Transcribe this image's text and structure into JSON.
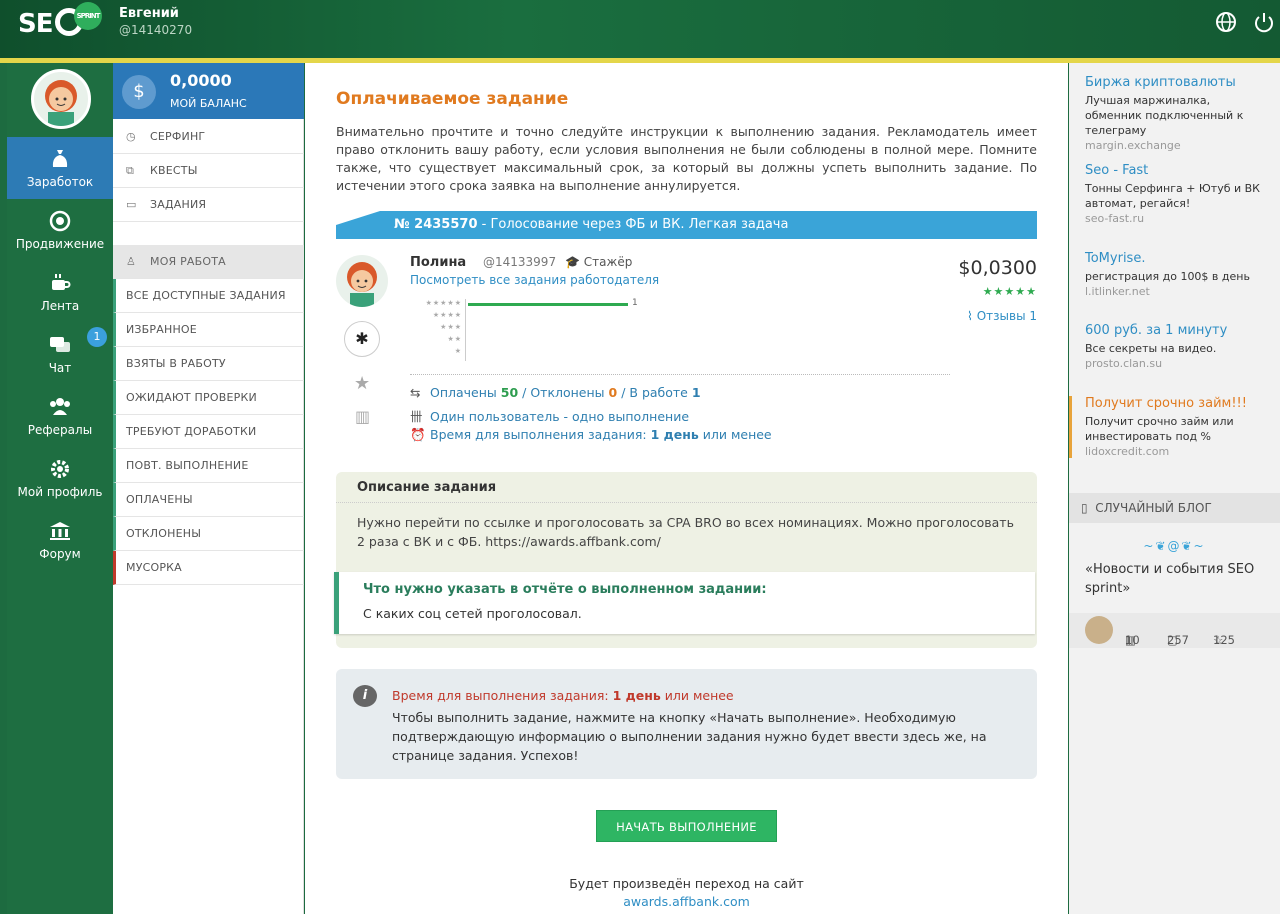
{
  "header": {
    "logo_text": "SE",
    "logo_badge": "SPRINT",
    "user_name": "Евгений",
    "user_id": "@14140270"
  },
  "left_nav": {
    "items": [
      {
        "label": "Заработок",
        "icon": "money-bag-icon",
        "active": true
      },
      {
        "label": "Продвижение",
        "icon": "target-icon"
      },
      {
        "label": "Лента",
        "icon": "coffee-icon"
      },
      {
        "label": "Чат",
        "icon": "chat-icon",
        "badge": "1"
      },
      {
        "label": "Рефералы",
        "icon": "people-icon"
      },
      {
        "label": "Мой профиль",
        "icon": "gear-icon"
      },
      {
        "label": "Форум",
        "icon": "building-icon"
      }
    ]
  },
  "balance": {
    "amount": "0,0000",
    "label": "МОЙ БАЛАНС"
  },
  "menu": {
    "top": [
      {
        "label": "СЕРФИНГ",
        "icon": "clock-icon"
      },
      {
        "label": "КВЕСТЫ",
        "icon": "puzzle-icon"
      },
      {
        "label": "ЗАДАНИЯ",
        "icon": "briefcase-icon"
      }
    ],
    "work_header": "МОЯ РАБОТА",
    "work": [
      "ВСЕ ДОСТУПНЫЕ ЗАДАНИЯ",
      "ИЗБРАННОЕ",
      "ВЗЯТЫ В РАБОТУ",
      "ОЖИДАЮТ ПРОВЕРКИ",
      "ТРЕБУЮТ ДОРАБОТКИ",
      "ПОВТ. ВЫПОЛНЕНИЕ",
      "ОПЛАЧЕНЫ",
      "ОТКЛОНЕНЫ",
      "МУСОРКА"
    ]
  },
  "main": {
    "title": "Оплачиваемое задание",
    "intro": "Внимательно прочтите и точно следуйте инструкции к выполнению задания. Рекламодатель имеет право отклонить вашу работу, если условия выполнения не были соблюдены в полной мере. Помните также, что существует максимальный срок, за который вы должны успеть выполнить задание. По истечении этого срока заявка на выполнение аннулируется.",
    "task_number": "№ 2435570",
    "task_title": " - Голосование через ФБ и ВК. Легкая задача",
    "employer": {
      "name": "Полина",
      "id": "@14133997",
      "rank": "Стажёр",
      "link": "Посмотреть все задания работодателя"
    },
    "price": "$0,0300",
    "stars": "★★★★★",
    "reviews": "Отзывы 1",
    "rating_rows": [
      {
        "stars": "★★★★★",
        "count": "1",
        "fraction": 1.0
      },
      {
        "stars": "★★★★",
        "count": "",
        "fraction": 0
      },
      {
        "stars": "★★★",
        "count": "",
        "fraction": 0
      },
      {
        "stars": "★★",
        "count": "",
        "fraction": 0
      },
      {
        "stars": "★",
        "count": "",
        "fraction": 0
      }
    ],
    "stats": {
      "paid_label": "Оплачены",
      "paid": "50",
      "rejected_label": " / Отклонены",
      "rejected": "0",
      "inwork_label": " / В работе",
      "inwork": "1"
    },
    "one_user": "Один пользователь - одно выполнение",
    "time_label": "Время для выполнения задания:",
    "time_value": "1 день",
    "time_suffix": "или менее",
    "desc_title": "Описание задания",
    "desc_text": "Нужно перейти по ссылке и проголосовать за CPA BRO во всех номинациях. Можно проголосовать 2 раза с ВК и с ФБ. https://awards.affbank.com/",
    "report_title": "Что нужно указать в отчёте о выполненном задании:",
    "report_text": "С каких соц сетей проголосовал.",
    "note_time_label": "Время для выполнения задания:",
    "note_time_value": "1 день",
    "note_time_suffix": "или менее",
    "note_text": "Чтобы выполнить задание, нажмите на кнопку «Начать выполнение». Необходимую подтверждающую информацию о выполнении задания нужно будет ввести здесь же, на странице задания. Успехов!",
    "start_button": "НАЧАТЬ ВЫПОЛНЕНИЕ",
    "redirect_text": "Будет произведён переход на сайт",
    "redirect_link": "awards.affbank.com"
  },
  "ads": [
    {
      "title": "Биржа криптовалюты",
      "text": "Лучшая маржиналка, обменник подключенный к телеграму",
      "url": "margin.exchange"
    },
    {
      "title": "Seo - Fast",
      "text": "Тонны Серфинга + Ютуб и ВК автомат, регайся!",
      "url": "seo-fast.ru"
    },
    {
      "title": "ToMyrise.",
      "text": "регистрация до 100$ в день",
      "url": "l.itlinker.net"
    },
    {
      "title": "600 руб. за 1 минуту",
      "text": "Все секреты на видео.",
      "url": "prosto.clan.su"
    },
    {
      "title": "Получит срочно займ!!!",
      "text": "Получит срочно займ или инвестировать под %",
      "url": "lidoxcredit.com"
    }
  ],
  "blog": {
    "header": "СЛУЧАЙНЫЙ БЛОГ",
    "title": "«Новости и события SEO sprint»",
    "posts": "10",
    "comments": "257",
    "stars": "125"
  }
}
